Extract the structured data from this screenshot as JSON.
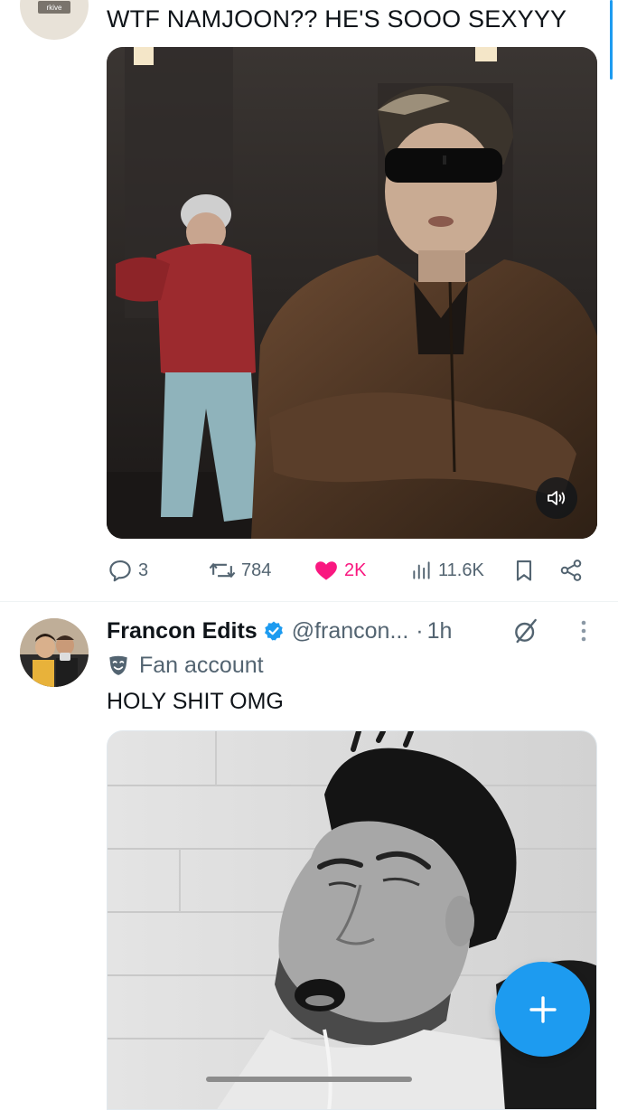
{
  "tweet1": {
    "avatar_text": "rkive",
    "text": "WTF NAMJOON?? HE'S SOOO SEXYYY",
    "media": {
      "type": "video",
      "volume_icon": "volume-icon"
    },
    "actions": {
      "replies": "3",
      "reposts": "784",
      "likes": "2K",
      "liked": true,
      "views": "11.6K"
    }
  },
  "tweet2": {
    "display_name": "Francon Edits",
    "verified": true,
    "handle": "@francon...",
    "separator": "·",
    "time": "1h",
    "label": "Fan account",
    "label_icon": "theater-masks-icon",
    "text": "HOLY SHIT OMG",
    "media": {
      "type": "image"
    }
  },
  "fab": {
    "icon": "plus-icon"
  },
  "colors": {
    "accent": "#1d9bf0",
    "like": "#f91880",
    "secondary_text": "#536471",
    "primary_text": "#0f1419"
  }
}
